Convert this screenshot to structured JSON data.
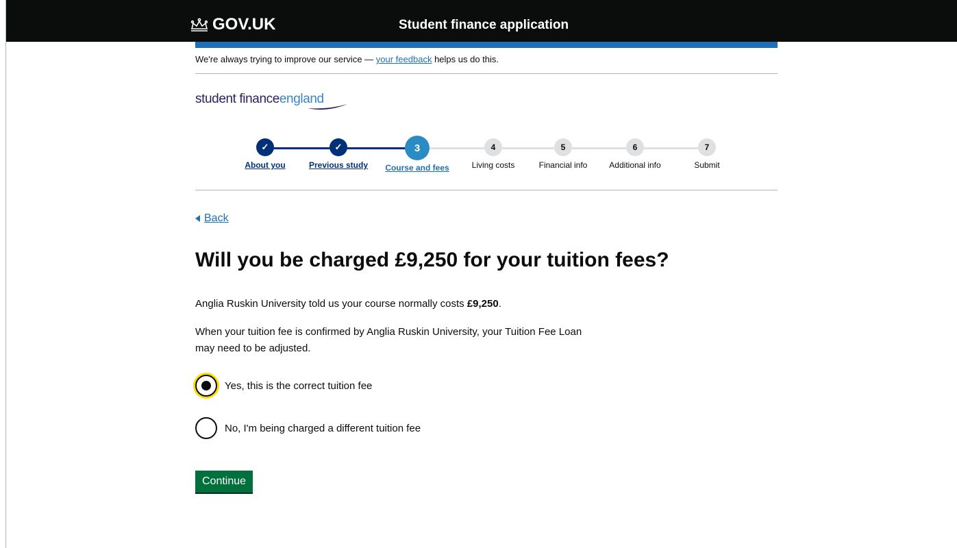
{
  "header": {
    "logo_text": "GOV.UK",
    "service_name": "Student finance application"
  },
  "feedback": {
    "prefix": "We're always trying to improve our service — ",
    "link": "your feedback",
    "suffix": " helps us do this."
  },
  "brand": {
    "part1": "student finance",
    "part2": "england"
  },
  "steps": [
    {
      "number": "✓",
      "label": "About you",
      "state": "done"
    },
    {
      "number": "✓",
      "label": "Previous study",
      "state": "done"
    },
    {
      "number": "3",
      "label": "Course and fees",
      "state": "current"
    },
    {
      "number": "4",
      "label": "Living costs",
      "state": "todo"
    },
    {
      "number": "5",
      "label": "Financial info",
      "state": "todo"
    },
    {
      "number": "6",
      "label": "Additional info",
      "state": "todo"
    },
    {
      "number": "7",
      "label": "Submit",
      "state": "todo"
    }
  ],
  "back_label": "Back",
  "question": "Will you be charged £9,250 for your tuition fees?",
  "body": {
    "p1_prefix": "Anglia Ruskin University told us your course normally costs ",
    "p1_amount": "£9,250",
    "p1_suffix": ".",
    "p2": "When your tuition fee is confirmed by Anglia Ruskin University, your Tuition Fee Loan may need to be adjusted."
  },
  "options": [
    {
      "label": "Yes, this is the correct tuition fee",
      "selected": true
    },
    {
      "label": "No, I'm being charged a different tuition fee",
      "selected": false
    }
  ],
  "continue_label": "Continue",
  "colors": {
    "header_bg": "#0b0c0c",
    "accent_blue": "#1d70b8",
    "done_step": "#003078",
    "current_step": "#2b8cc4",
    "todo_step": "#dee0e2",
    "button_green": "#00703c",
    "focus_yellow": "#ffdd00"
  }
}
